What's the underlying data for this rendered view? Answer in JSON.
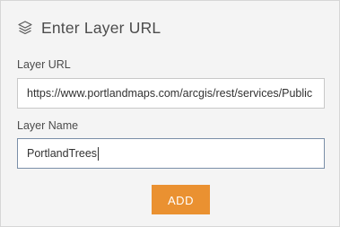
{
  "panel": {
    "title": "Enter Layer URL",
    "title_icon": "layers-icon"
  },
  "layer_url": {
    "label": "Layer URL",
    "value": "https://www.portlandmaps.com/arcgis/rest/services/Public"
  },
  "layer_name": {
    "label": "Layer Name",
    "value": "PortlandTrees"
  },
  "actions": {
    "add_label": "ADD"
  },
  "colors": {
    "accent": "#ea9131",
    "panel_bg": "#f4f4f4",
    "text": "#4c4c4c"
  }
}
